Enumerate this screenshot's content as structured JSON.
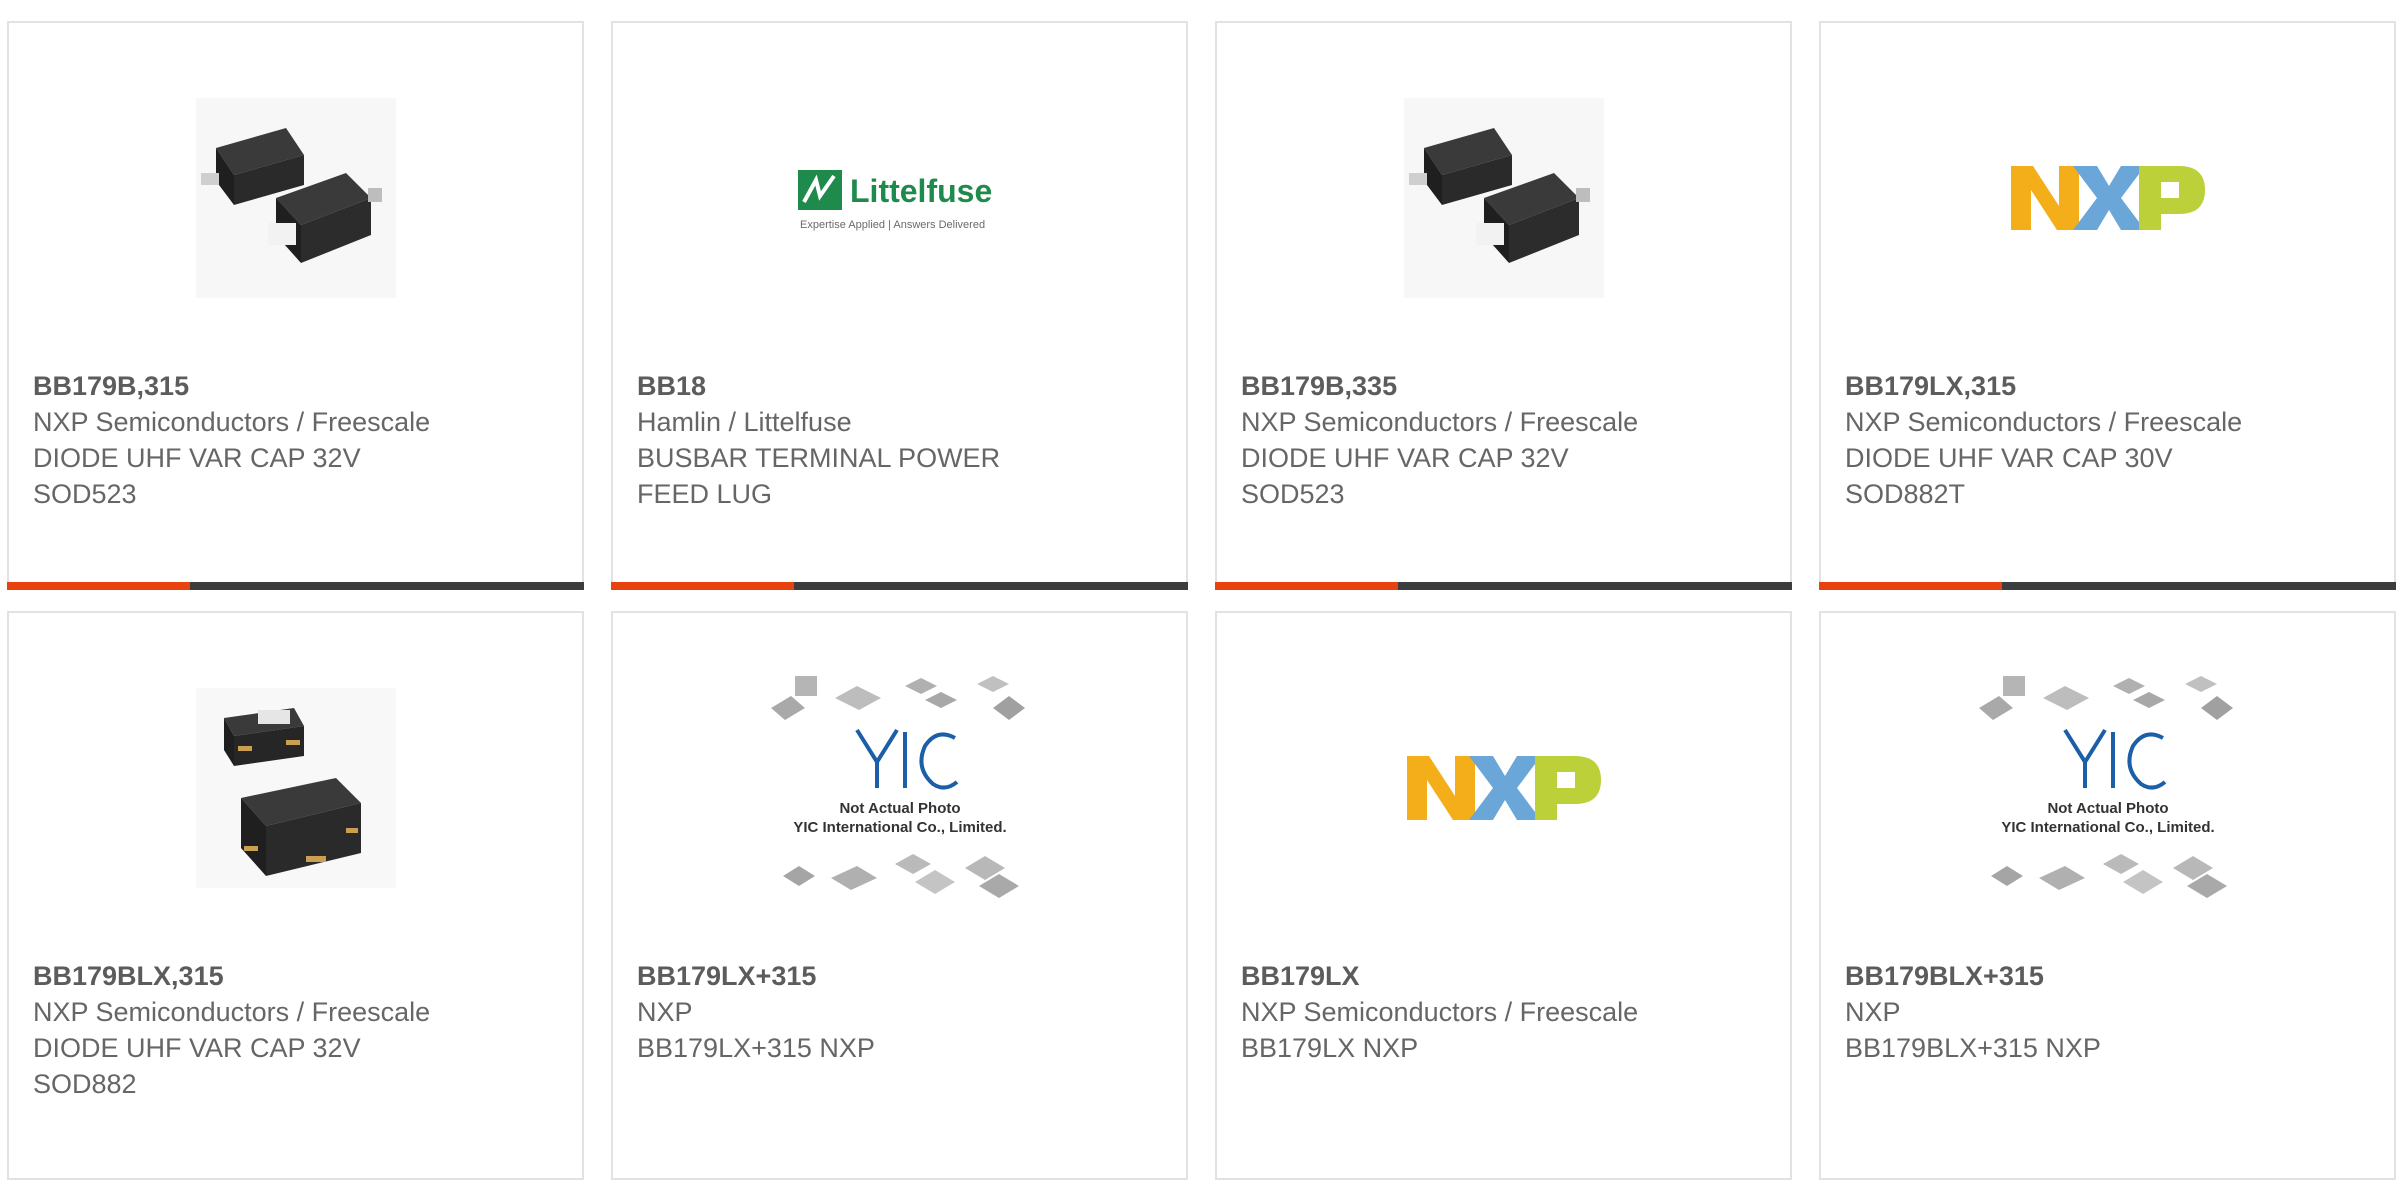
{
  "colors": {
    "accent": "#e8420f",
    "bar_dark": "#3d3d3d",
    "border": "#e2e2e2",
    "text": "#666666"
  },
  "products": [
    {
      "part": "BB179B,315",
      "manufacturer": "NXP Semiconductors / Freescale",
      "description": "DIODE UHF VAR CAP 32V SOD523",
      "image": "sod523-package-image"
    },
    {
      "part": "BB18",
      "manufacturer": "Hamlin / Littelfuse",
      "description": "BUSBAR TERMINAL POWER FEED LUG",
      "image": "littelfuse-logo",
      "logo": {
        "name": "Littelfuse",
        "tagline": "Expertise Applied | Answers Delivered"
      }
    },
    {
      "part": "BB179B,335",
      "manufacturer": "NXP Semiconductors / Freescale",
      "description": "DIODE UHF VAR CAP 32V SOD523",
      "image": "sod523-package-image"
    },
    {
      "part": "BB179LX,315",
      "manufacturer": "NXP Semiconductors / Freescale",
      "description": "DIODE UHF VAR CAP 30V SOD882T",
      "image": "nxp-logo"
    },
    {
      "part": "BB179BLX,315",
      "manufacturer": "NXP Semiconductors / Freescale",
      "description": "DIODE UHF VAR CAP 32V SOD882",
      "image": "sod882-package-image"
    },
    {
      "part": "BB179LX+315",
      "manufacturer": "NXP",
      "description": "BB179LX+315 NXP",
      "image": "yic-placeholder-image",
      "placeholder": {
        "brand": "YIC",
        "line1": "Not Actual Photo",
        "line2": "YIC International Co., Limited."
      }
    },
    {
      "part": "BB179LX",
      "manufacturer": "NXP Semiconductors / Freescale",
      "description": "BB179LX NXP",
      "image": "nxp-logo"
    },
    {
      "part": "BB179BLX+315",
      "manufacturer": "NXP",
      "description": "BB179BLX+315 NXP",
      "image": "yic-placeholder-image",
      "placeholder": {
        "brand": "YIC",
        "line1": "Not Actual Photo",
        "line2": "YIC International Co., Limited."
      }
    }
  ]
}
